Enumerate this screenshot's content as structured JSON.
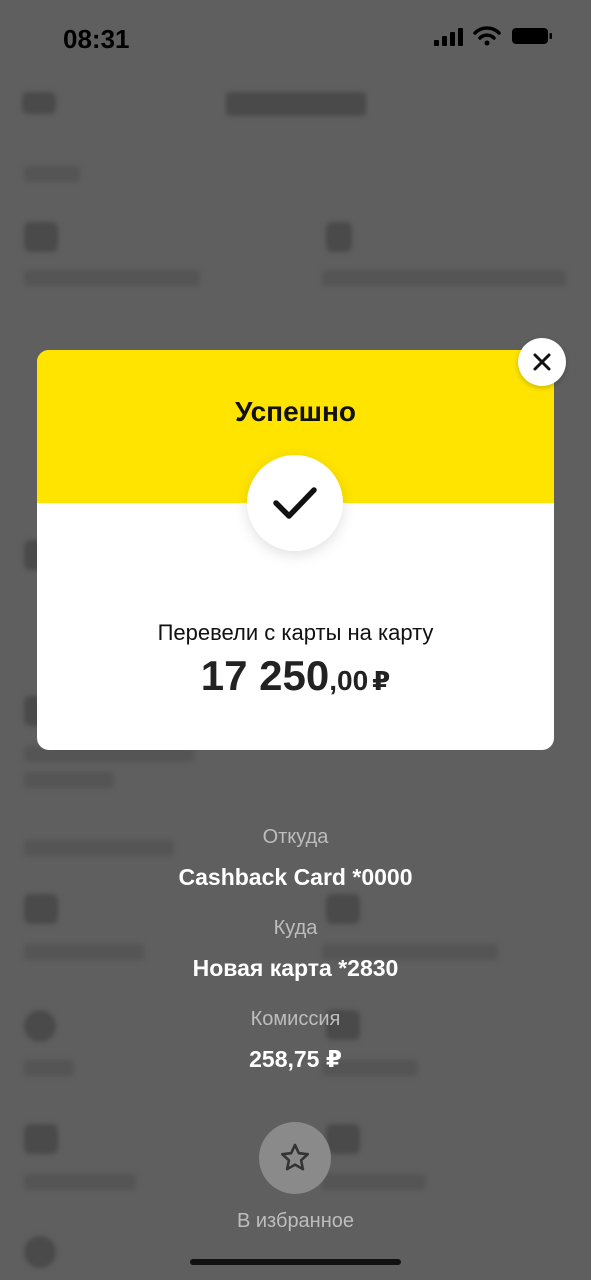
{
  "status_bar": {
    "time": "08:31"
  },
  "modal": {
    "title": "Успешно",
    "description": "Перевели с карты на карту",
    "amount_int": "17 250",
    "amount_dec": ",00",
    "currency": "₽"
  },
  "details": {
    "from_label": "Откуда",
    "from_value": "Cashback Card *0000",
    "to_label": "Куда",
    "to_value": "Новая карта *2830",
    "fee_label": "Комиссия",
    "fee_value": "258,75 ₽"
  },
  "favorite": {
    "label": "В избранное"
  },
  "colors": {
    "accent": "#ffe400",
    "overlay": "#5f5f5f"
  },
  "icons": [
    "check-icon",
    "close-icon",
    "star-icon",
    "signal-icon",
    "wifi-icon",
    "battery-icon"
  ]
}
